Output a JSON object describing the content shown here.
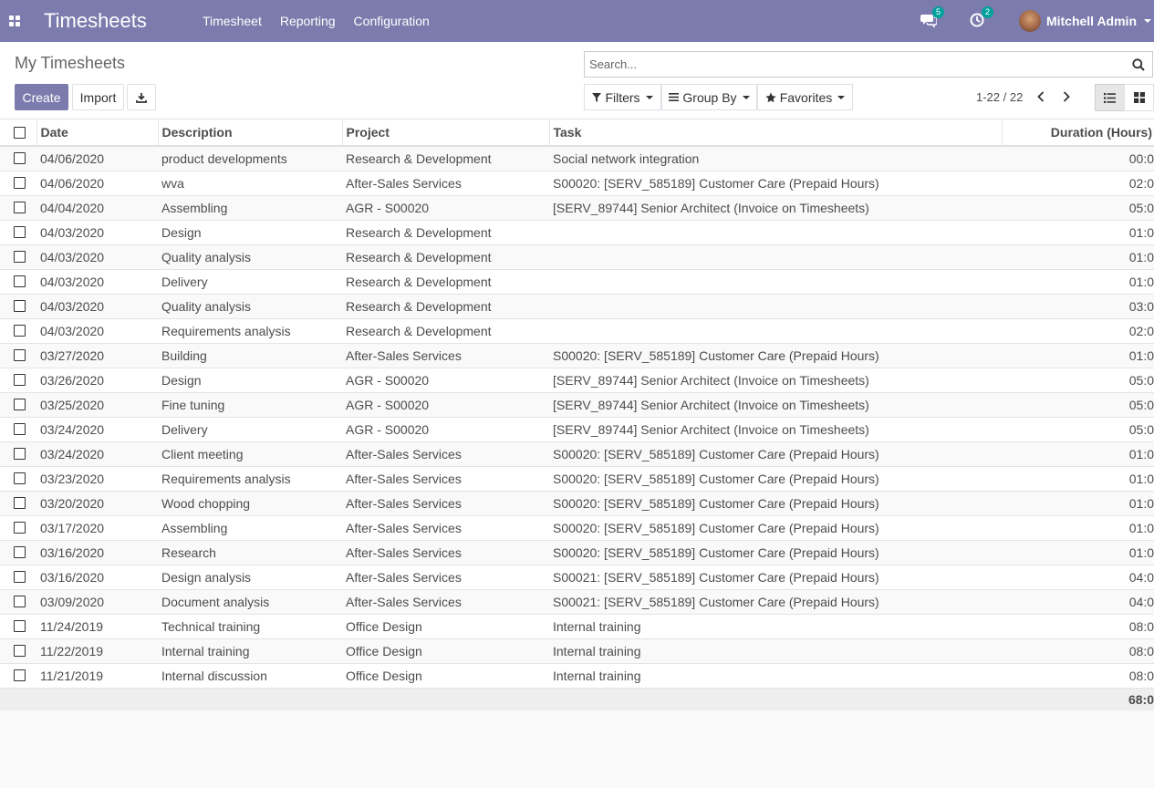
{
  "navbar": {
    "brand": "Timesheets",
    "menu": [
      "Timesheet",
      "Reporting",
      "Configuration"
    ],
    "messages_badge": "5",
    "activities_badge": "2",
    "user_name": "Mitchell Admin"
  },
  "control": {
    "title": "My Timesheets",
    "create_label": "Create",
    "import_label": "Import",
    "search_placeholder": "Search...",
    "filters_label": "Filters",
    "groupby_label": "Group By",
    "favorites_label": "Favorites",
    "pager": "1-22 / 22"
  },
  "table": {
    "headers": {
      "date": "Date",
      "description": "Description",
      "project": "Project",
      "task": "Task",
      "duration": "Duration (Hours)"
    },
    "rows": [
      {
        "date": "04/06/2020",
        "description": "product developments",
        "project": "Research & Development",
        "task": "Social network integration",
        "duration": "00:0"
      },
      {
        "date": "04/06/2020",
        "description": "wva",
        "project": "After-Sales Services",
        "task": "S00020: [SERV_585189] Customer Care (Prepaid Hours)",
        "duration": "02:0"
      },
      {
        "date": "04/04/2020",
        "description": "Assembling",
        "project": "AGR - S00020",
        "task": "[SERV_89744] Senior Architect (Invoice on Timesheets)",
        "duration": "05:0"
      },
      {
        "date": "04/03/2020",
        "description": "Design",
        "project": "Research & Development",
        "task": "",
        "duration": "01:0"
      },
      {
        "date": "04/03/2020",
        "description": "Quality analysis",
        "project": "Research & Development",
        "task": "",
        "duration": "01:0"
      },
      {
        "date": "04/03/2020",
        "description": "Delivery",
        "project": "Research & Development",
        "task": "",
        "duration": "01:0"
      },
      {
        "date": "04/03/2020",
        "description": "Quality analysis",
        "project": "Research & Development",
        "task": "",
        "duration": "03:0"
      },
      {
        "date": "04/03/2020",
        "description": "Requirements analysis",
        "project": "Research & Development",
        "task": "",
        "duration": "02:0"
      },
      {
        "date": "03/27/2020",
        "description": "Building",
        "project": "After-Sales Services",
        "task": "S00020: [SERV_585189] Customer Care (Prepaid Hours)",
        "duration": "01:0"
      },
      {
        "date": "03/26/2020",
        "description": "Design",
        "project": "AGR - S00020",
        "task": "[SERV_89744] Senior Architect (Invoice on Timesheets)",
        "duration": "05:0"
      },
      {
        "date": "03/25/2020",
        "description": "Fine tuning",
        "project": "AGR - S00020",
        "task": "[SERV_89744] Senior Architect (Invoice on Timesheets)",
        "duration": "05:0"
      },
      {
        "date": "03/24/2020",
        "description": "Delivery",
        "project": "AGR - S00020",
        "task": "[SERV_89744] Senior Architect (Invoice on Timesheets)",
        "duration": "05:0"
      },
      {
        "date": "03/24/2020",
        "description": "Client meeting",
        "project": "After-Sales Services",
        "task": "S00020: [SERV_585189] Customer Care (Prepaid Hours)",
        "duration": "01:0"
      },
      {
        "date": "03/23/2020",
        "description": "Requirements analysis",
        "project": "After-Sales Services",
        "task": "S00020: [SERV_585189] Customer Care (Prepaid Hours)",
        "duration": "01:0"
      },
      {
        "date": "03/20/2020",
        "description": "Wood chopping",
        "project": "After-Sales Services",
        "task": "S00020: [SERV_585189] Customer Care (Prepaid Hours)",
        "duration": "01:0"
      },
      {
        "date": "03/17/2020",
        "description": "Assembling",
        "project": "After-Sales Services",
        "task": "S00020: [SERV_585189] Customer Care (Prepaid Hours)",
        "duration": "01:0"
      },
      {
        "date": "03/16/2020",
        "description": "Research",
        "project": "After-Sales Services",
        "task": "S00020: [SERV_585189] Customer Care (Prepaid Hours)",
        "duration": "01:0"
      },
      {
        "date": "03/16/2020",
        "description": "Design analysis",
        "project": "After-Sales Services",
        "task": "S00021: [SERV_585189] Customer Care (Prepaid Hours)",
        "duration": "04:0"
      },
      {
        "date": "03/09/2020",
        "description": "Document analysis",
        "project": "After-Sales Services",
        "task": "S00021: [SERV_585189] Customer Care (Prepaid Hours)",
        "duration": "04:0"
      },
      {
        "date": "11/24/2019",
        "description": "Technical training",
        "project": "Office Design",
        "task": "Internal training",
        "duration": "08:0"
      },
      {
        "date": "11/22/2019",
        "description": "Internal training",
        "project": "Office Design",
        "task": "Internal training",
        "duration": "08:0"
      },
      {
        "date": "11/21/2019",
        "description": "Internal discussion",
        "project": "Office Design",
        "task": "Internal training",
        "duration": "08:0"
      }
    ],
    "total": "68:0"
  }
}
